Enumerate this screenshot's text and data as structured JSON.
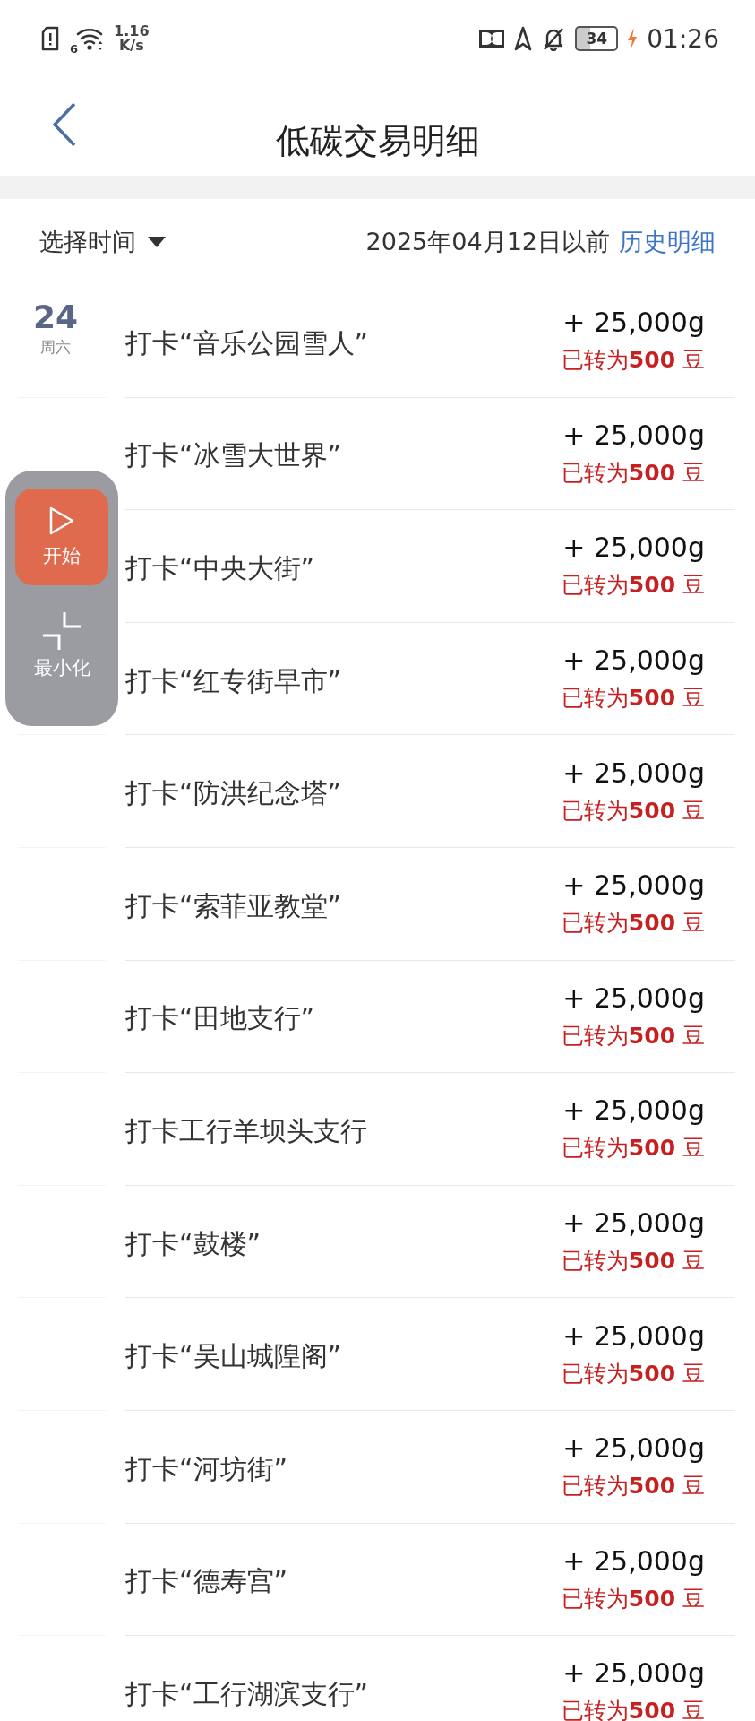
{
  "status_bar": {
    "network_speed": "1.16",
    "speed_unit": "K/s",
    "wifi_generation": "6",
    "battery": "34",
    "time": "01:26"
  },
  "header": {
    "title": "低碳交易明细"
  },
  "filter": {
    "label": "选择时间",
    "range": "2025年04月12日以前",
    "link": "历史明细"
  },
  "date": {
    "day": "24",
    "weekday": "周六"
  },
  "records": [
    {
      "title": "打卡“音乐公园雪人”",
      "amount": "+ 25,000g",
      "converted_prefix": "已转为",
      "converted_value": "500",
      "converted_unit": "豆"
    },
    {
      "title": "打卡“冰雪大世界”",
      "amount": "+ 25,000g",
      "converted_prefix": "已转为",
      "converted_value": "500",
      "converted_unit": "豆"
    },
    {
      "title": "打卡“中央大街”",
      "amount": "+ 25,000g",
      "converted_prefix": "已转为",
      "converted_value": "500",
      "converted_unit": "豆"
    },
    {
      "title": "打卡“红专街早市”",
      "amount": "+ 25,000g",
      "converted_prefix": "已转为",
      "converted_value": "500",
      "converted_unit": "豆"
    },
    {
      "title": "打卡“防洪纪念塔”",
      "amount": "+ 25,000g",
      "converted_prefix": "已转为",
      "converted_value": "500",
      "converted_unit": "豆"
    },
    {
      "title": "打卡“索菲亚教堂”",
      "amount": "+ 25,000g",
      "converted_prefix": "已转为",
      "converted_value": "500",
      "converted_unit": "豆"
    },
    {
      "title": "打卡“田地支行”",
      "amount": "+ 25,000g",
      "converted_prefix": "已转为",
      "converted_value": "500",
      "converted_unit": "豆"
    },
    {
      "title": "打卡工行羊坝头支行",
      "amount": "+ 25,000g",
      "converted_prefix": "已转为",
      "converted_value": "500",
      "converted_unit": "豆"
    },
    {
      "title": "打卡“鼓楼”",
      "amount": "+ 25,000g",
      "converted_prefix": "已转为",
      "converted_value": "500",
      "converted_unit": "豆"
    },
    {
      "title": "打卡“吴山城隍阁”",
      "amount": "+ 25,000g",
      "converted_prefix": "已转为",
      "converted_value": "500",
      "converted_unit": "豆"
    },
    {
      "title": "打卡“河坊街”",
      "amount": "+ 25,000g",
      "converted_prefix": "已转为",
      "converted_value": "500",
      "converted_unit": "豆"
    },
    {
      "title": "打卡“德寿宫”",
      "amount": "+ 25,000g",
      "converted_prefix": "已转为",
      "converted_value": "500",
      "converted_unit": "豆"
    },
    {
      "title": "打卡“工行湖滨支行”",
      "amount": "+ 25,000g",
      "converted_prefix": "已转为",
      "converted_value": "500",
      "converted_unit": "豆"
    }
  ],
  "floating_widget": {
    "start_label": "开始",
    "minimize_label": "最小化"
  }
}
